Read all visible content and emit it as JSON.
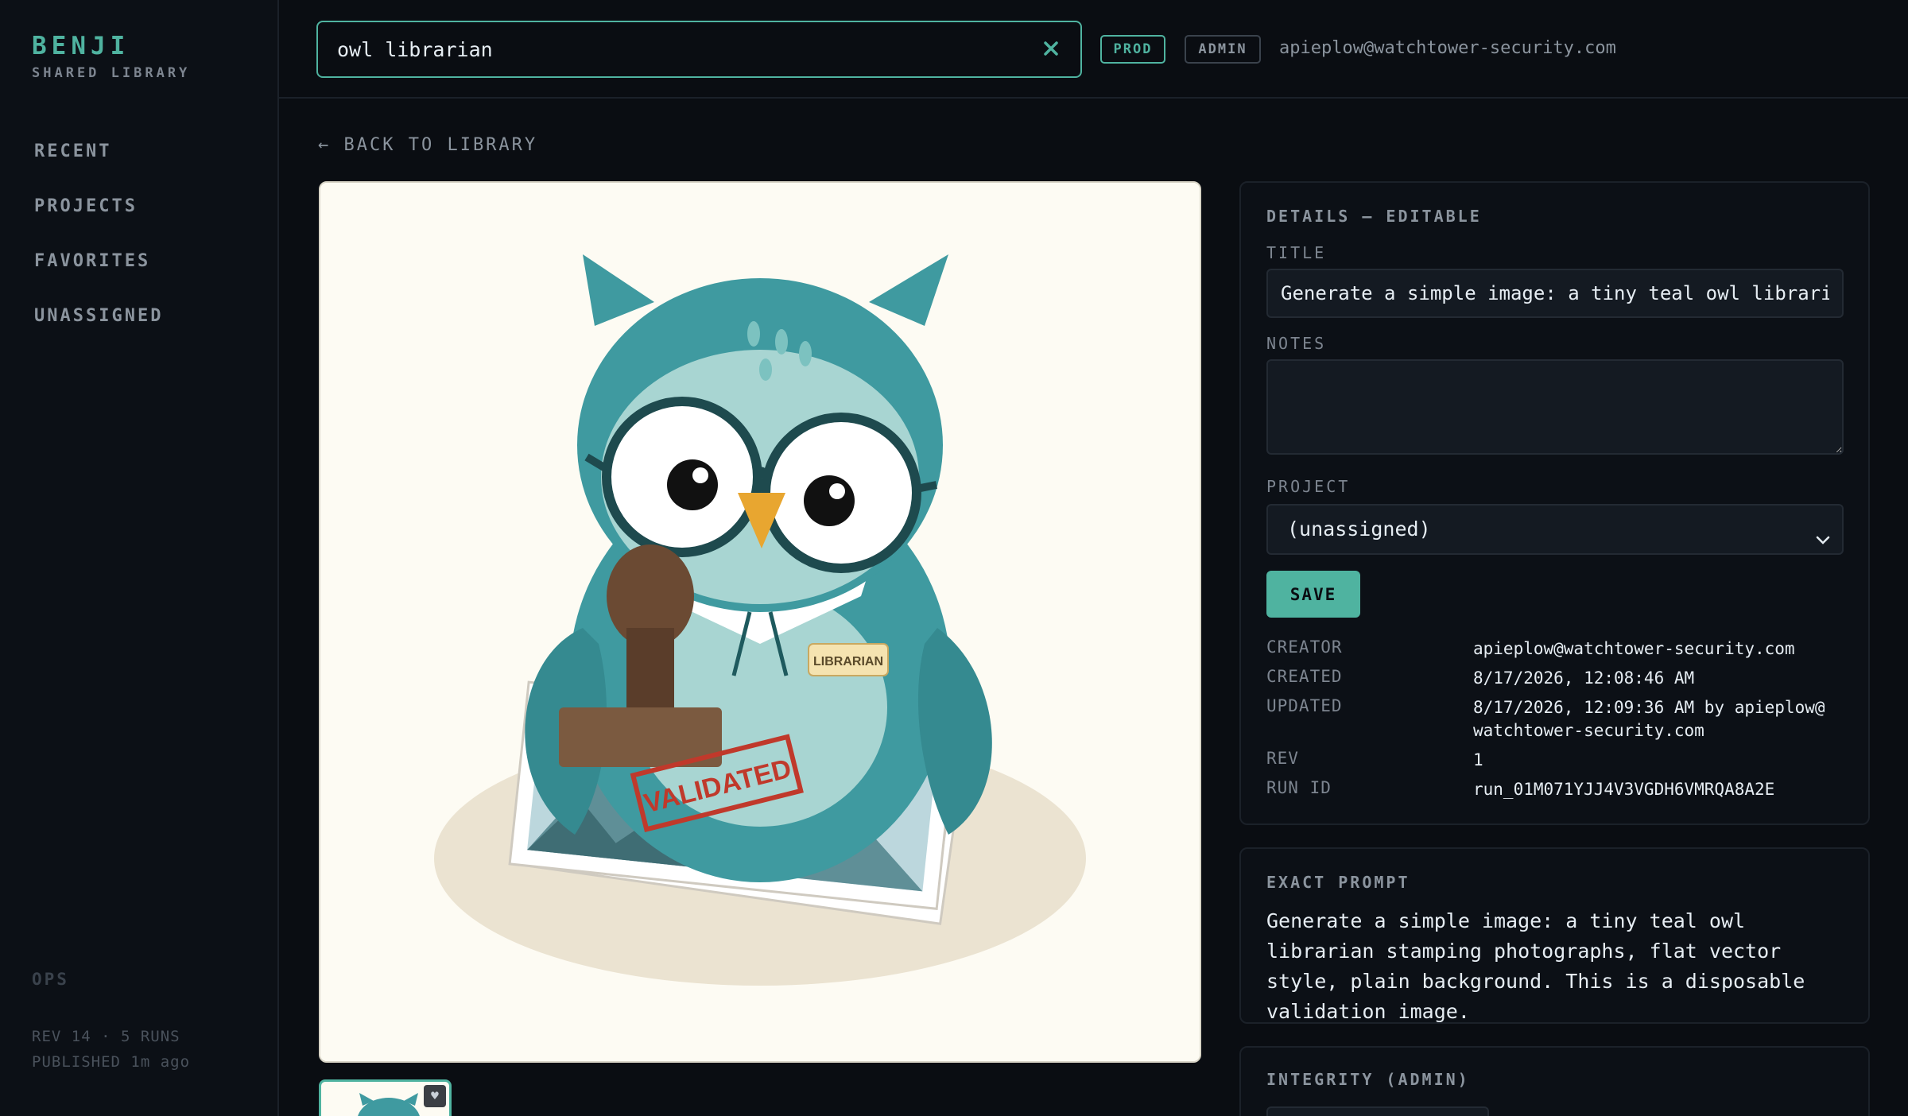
{
  "brand": {
    "name": "BENJI",
    "subtitle": "SHARED LIBRARY"
  },
  "nav": {
    "items": [
      {
        "label": "RECENT"
      },
      {
        "label": "PROJECTS"
      },
      {
        "label": "FAVORITES"
      },
      {
        "label": "UNASSIGNED"
      }
    ]
  },
  "sidebar_footer": {
    "section": "OPS",
    "line1": "REV 14 · 5 RUNS",
    "line2": "PUBLISHED 1m ago"
  },
  "search": {
    "value": "owl librarian"
  },
  "badges": {
    "env": "PROD",
    "role": "ADMIN"
  },
  "user": {
    "email": "apieplow@watchtower-security.com"
  },
  "back_link": "← BACK TO LIBRARY",
  "image": {
    "name_tag": "LIBRARIAN",
    "stamp_text": "VALIDATED",
    "colors": {
      "owl": "#3f9aa0",
      "background": "#fdfbf3",
      "stamp": "#c0392b"
    }
  },
  "details": {
    "heading": "DETAILS — EDITABLE",
    "title_label": "TITLE",
    "title_value": "Generate a simple image: a tiny teal owl librarian stamping photographs, flat vector style, plain background. This is a disposable validation image.",
    "notes_label": "NOTES",
    "notes_value": "",
    "project_label": "PROJECT",
    "project_value": "(unassigned)",
    "save_label": "SAVE",
    "meta": [
      {
        "key": "CREATOR",
        "value": "apieplow@watchtower-security.com"
      },
      {
        "key": "CREATED",
        "value": "8/17/2026, 12:08:46 AM"
      },
      {
        "key": "UPDATED",
        "value": "8/17/2026, 12:09:36 AM by apieplow@ watchtower-security.com"
      },
      {
        "key": "REV",
        "value": "1"
      },
      {
        "key": "RUN ID",
        "value": "run_01M071YJJ4V3VGDH6VMRQA8A2E"
      }
    ]
  },
  "exact_prompt": {
    "heading": "EXACT PROMPT",
    "text": "Generate a simple image: a tiny teal owl librarian stamping photographs, flat vector style, plain background. This is a disposable validation image."
  },
  "integrity": {
    "heading": "INTEGRITY (ADMIN)"
  },
  "colors": {
    "accent": "#4fb3a0",
    "background": "#0a0d12",
    "panel": "#0c1016"
  }
}
